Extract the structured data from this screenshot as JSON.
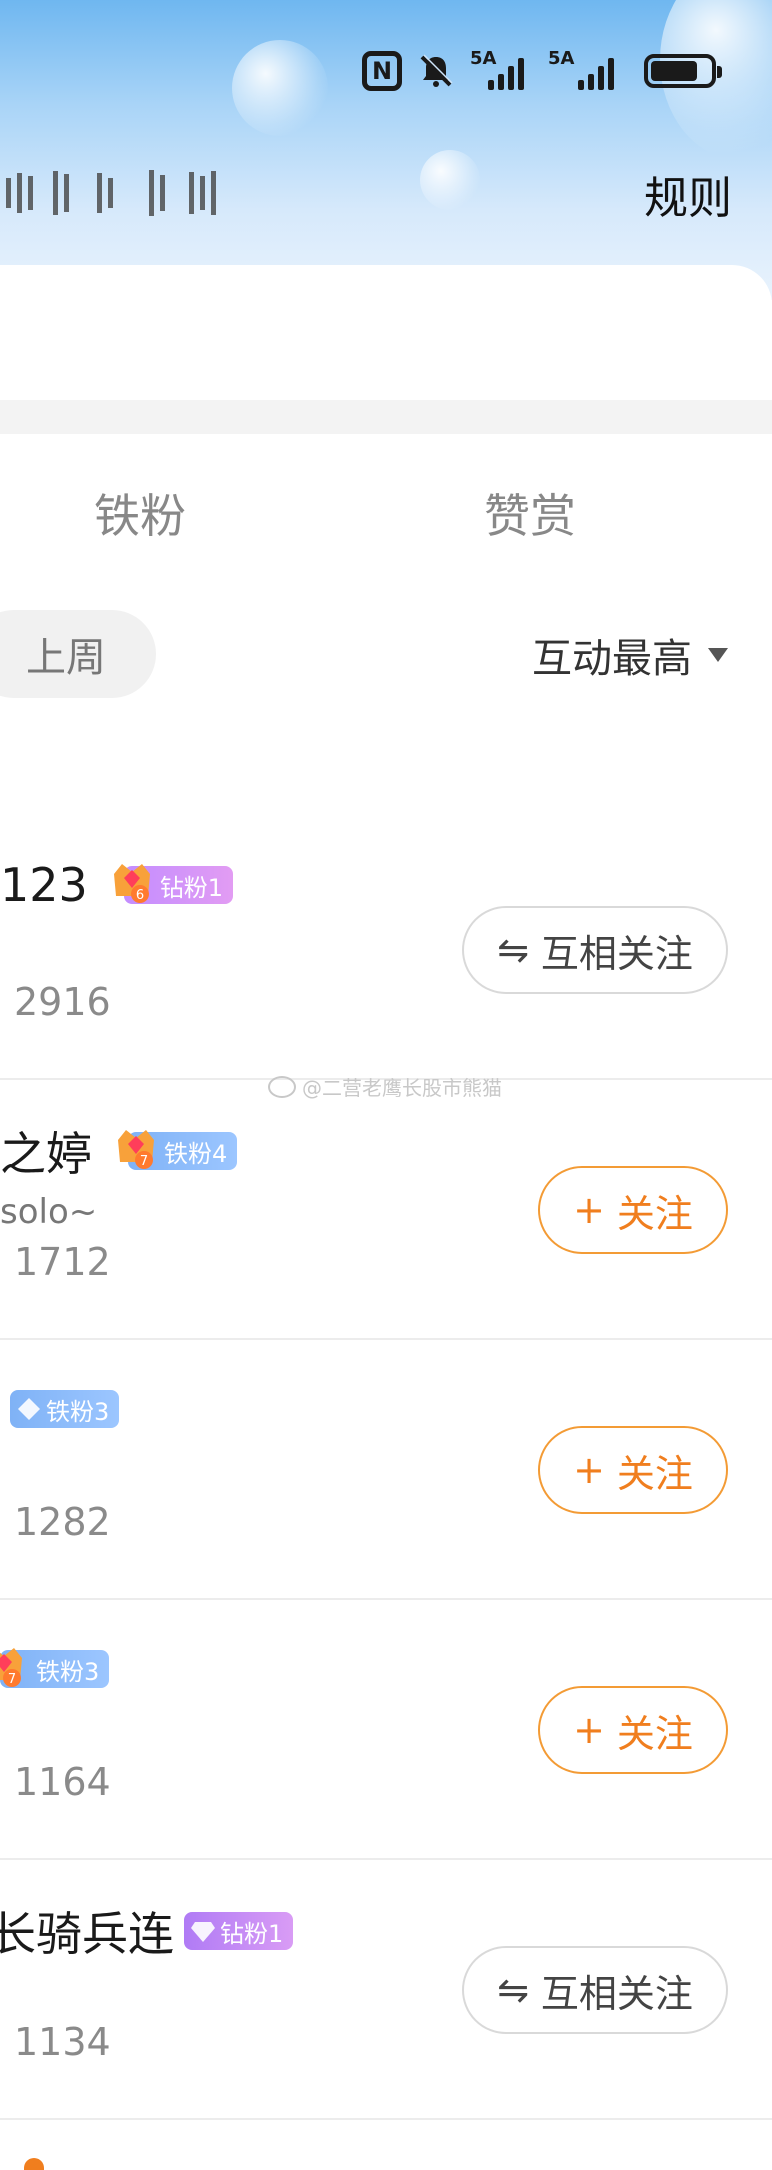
{
  "header": {
    "rules_label": "规则",
    "status": {
      "signal_1": "5A",
      "signal_2": "5A"
    }
  },
  "tabs": [
    {
      "label": "铁粉"
    },
    {
      "label": "赞赏"
    }
  ],
  "filters": {
    "period": "上周",
    "sort": "互动最高"
  },
  "rows": [
    {
      "name": "123",
      "sub": "",
      "score": "2916",
      "badge": "钻粉1",
      "badge_level": "6",
      "button": "互相关注"
    },
    {
      "name": "之婷",
      "sub": "solo~",
      "score": "1712",
      "badge": "铁粉4",
      "badge_level": "7",
      "button": "关注"
    },
    {
      "name": "",
      "sub": "",
      "score": "1282",
      "badge": "铁粉3",
      "badge_level": "",
      "button": "关注"
    },
    {
      "name": "",
      "sub": "",
      "score": "1164",
      "badge": "铁粉3",
      "badge_level": "7",
      "button": "关注"
    },
    {
      "name": "长骑兵连",
      "sub": "",
      "score": "1134",
      "badge": "钻粉1",
      "badge_level": "",
      "button": "互相关注"
    }
  ],
  "watermark": "@二营老鹰长股市熊猫",
  "colors": {
    "accent": "#f07e1e",
    "diamond_badge": "#c38dff",
    "iron_badge": "#7fb2f6"
  }
}
